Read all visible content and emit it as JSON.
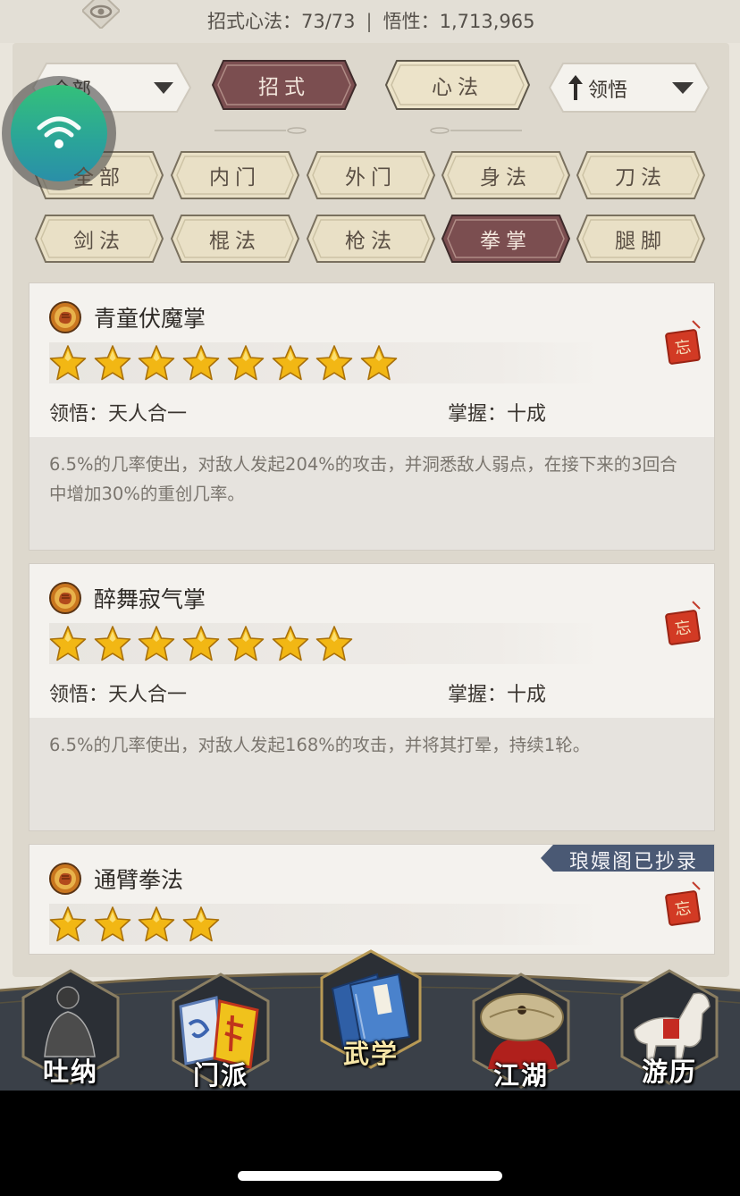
{
  "header": {
    "moves_label": "招式心法：73/73",
    "insight_label": "悟性：1,713,965",
    "separator": "|"
  },
  "controls": {
    "filter_dropdown_value": "全部",
    "tab_moves": "招式",
    "tab_mental": "心法",
    "sort_dropdown_value": "领悟"
  },
  "categories": [
    "全部",
    "内门",
    "外门",
    "身法",
    "刀法",
    "剑法",
    "棍法",
    "枪法",
    "拳掌",
    "腿脚"
  ],
  "selected_category": "拳掌",
  "skills": [
    {
      "name": "青童伏魔掌",
      "stars": 8,
      "comprehension": "领悟：天人合一",
      "mastery": "掌握：十成",
      "description": "6.5%的几率使出，对敌人发起204%的攻击，并洞悉敌人弱点，在接下来的3回合中增加30%的重创几率。",
      "seal_char": "忘"
    },
    {
      "name": "醉舞寂气掌",
      "stars": 7,
      "comprehension": "领悟：天人合一",
      "mastery": "掌握：十成",
      "description": "6.5%的几率使出，对敌人发起168%的攻击，并将其打晕，持续1轮。",
      "seal_char": "忘"
    },
    {
      "name": "通臂拳法",
      "stars": 4,
      "badge": "琅嬛阁已抄录",
      "seal_char": "忘"
    }
  ],
  "bottom_nav": [
    {
      "label": "吐纳",
      "active": false
    },
    {
      "label": "门派",
      "active": false
    },
    {
      "label": "武学",
      "active": true
    },
    {
      "label": "江湖",
      "active": false
    },
    {
      "label": "游历",
      "active": false
    }
  ],
  "colors": {
    "selected_tab": "#7b4e50",
    "unselected_tab": "#e9e0c6",
    "accent_gold": "#f2b714",
    "ribbon": "#4a5974"
  }
}
